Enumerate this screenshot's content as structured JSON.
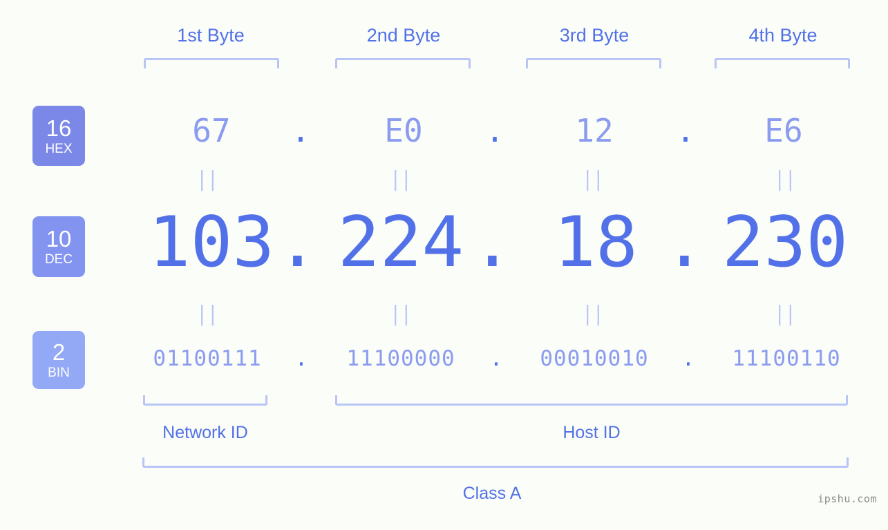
{
  "diagram": {
    "ip_address": "103.224.18.230",
    "watermark": "ipshu.com",
    "colors": {
      "background": "#fbfdf8",
      "badge_hex": "#7b88e8",
      "badge_dec": "#8294f0",
      "badge_bin": "#93a9f5",
      "accent_strong": "#5271e8",
      "accent_light": "#8b9bf0",
      "bracket": "#b9c4f7",
      "badge_text": "#ffffff",
      "watermark_text": "#8a8a8a"
    }
  },
  "byte_headers": [
    {
      "label": "1st Byte"
    },
    {
      "label": "2nd Byte"
    },
    {
      "label": "3rd Byte"
    },
    {
      "label": "4th Byte"
    }
  ],
  "badges": [
    {
      "base": "16",
      "name": "HEX"
    },
    {
      "base": "10",
      "name": "DEC"
    },
    {
      "base": "2",
      "name": "BIN"
    }
  ],
  "separators": {
    "dot": ".",
    "equals": "||"
  },
  "rows": {
    "hex": {
      "values": [
        "67",
        "E0",
        "12",
        "E6"
      ]
    },
    "dec": {
      "values": [
        "103",
        "224",
        "18",
        "230"
      ]
    },
    "bin": {
      "values": [
        "01100111",
        "11100000",
        "00010010",
        "11100110"
      ]
    }
  },
  "sections": [
    {
      "label": "Network ID"
    },
    {
      "label": "Host ID"
    },
    {
      "label": "Class A"
    }
  ]
}
